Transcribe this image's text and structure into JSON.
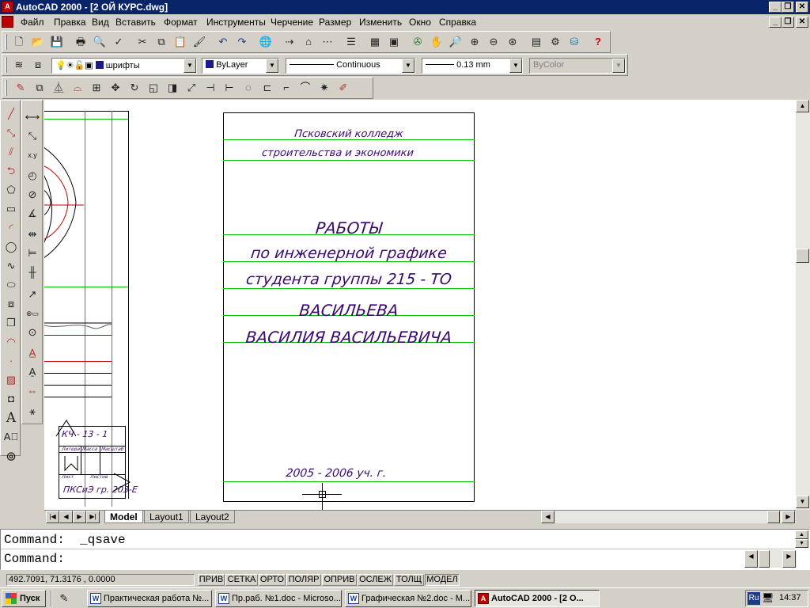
{
  "titlebar": {
    "title": "AutoCAD 2000 - [2 ОЙ КУРС.dwg]",
    "app_icon_glyph": "A"
  },
  "menu": [
    "Файл",
    "Правка",
    "Вид",
    "Вставить",
    "Формат",
    "Инструменты",
    "Черчение",
    "Размер",
    "Изменить",
    "Окно",
    "Справка"
  ],
  "standard_toolbar": {
    "help_glyph": "?"
  },
  "properties_toolbar": {
    "layer": "шрифты",
    "color": "ByLayer",
    "linetype": "Continuous",
    "lineweight": "0.13 mm",
    "plotstyle": "ByColor"
  },
  "icons": {
    "standard": [
      "new-icon",
      "open-icon",
      "save-icon",
      "print-icon",
      "preview-icon",
      "spell-icon",
      "cut-icon",
      "copy-icon",
      "paste-icon",
      "match-prop-icon",
      "undo-icon",
      "redo-icon",
      "hyperlink-icon",
      "snap-from-icon",
      "object-snap-icon",
      "tracking-icon",
      "properties-icon",
      "design-center-icon",
      "today-icon",
      "redraw-icon",
      "pan-icon",
      "zoom-realtime-icon",
      "zoom-window-icon",
      "zoom-prev-icon",
      "aerial-icon",
      "dbconnect-icon",
      "tool-palette-icon",
      "help-icon"
    ],
    "modify": [
      "erase-icon",
      "copy-object-icon",
      "mirror-icon",
      "offset-icon",
      "array-icon",
      "move-icon",
      "rotate-icon",
      "scale-icon",
      "stretch-icon",
      "lengthen-icon",
      "trim-icon",
      "extend-icon",
      "break-icon",
      "chamfer-icon",
      "fillet-icon",
      "explode-icon"
    ],
    "draw": [
      "line-icon",
      "construction-line-icon",
      "polyline-icon",
      "polygon-icon",
      "rectangle-icon",
      "arc-icon",
      "circle-icon",
      "spline-icon",
      "ellipse-icon",
      "insert-block-icon",
      "make-block-icon",
      "point-icon",
      "hatch-icon",
      "region-icon",
      "multiline-text-icon",
      "single-text-icon",
      "donut-icon"
    ],
    "dimension": [
      "linear-dim-icon",
      "aligned-dim-icon",
      "ordinate-dim-icon",
      "radius-dim-icon",
      "diameter-dim-icon",
      "angular-dim-icon",
      "quick-dim-icon",
      "baseline-dim-icon",
      "continue-dim-icon",
      "leader-icon",
      "tolerance-icon",
      "center-mark-icon",
      "dim-edit-icon",
      "dim-text-edit-icon",
      "dim-update-icon",
      "dim-style-icon"
    ]
  },
  "drawing": {
    "title_block": {
      "college_line1": "Псковский колледж",
      "college_line2": "строительства и экономики",
      "work_title": "РАБОТЫ",
      "subject": "по инженерной графике",
      "student_group": "студента группы 215 - ТО",
      "surname": "ВАСИЛЬЕВА",
      "name": "ВАСИЛИЯ ВАСИЛЬЕВИЧА",
      "year": "2005 - 2006 уч. г."
    },
    "left_sheet": {
      "stamp_code": "КЧ - 13 - 1",
      "stamp_cols": [
        "Литера",
        "Масса",
        "Масштаб"
      ],
      "stamp_sheet": [
        "Лист",
        "Листов"
      ],
      "stamp_org": "ПКСиЭ гр. 203-Е"
    }
  },
  "tabs": {
    "items": [
      "Model",
      "Layout1",
      "Layout2"
    ],
    "active": "Model"
  },
  "command": {
    "history": "Command:  _qsave",
    "prompt": "Command:"
  },
  "status": {
    "coords": "492.7091, 71.3176 , 0.0000",
    "toggles": [
      "ПРИВ",
      "СЕТКА",
      "ОРТО",
      "ПОЛЯР",
      "ОПРИВ",
      "ОСЛЕЖ",
      "ТОЛЩ",
      "МОДЕЛ"
    ]
  },
  "taskbar": {
    "start": "Пуск",
    "tasks": [
      {
        "label": "Практическая работа №...",
        "icon": "W"
      },
      {
        "label": "Пр.раб. №1.doc - Microso...",
        "icon": "W"
      },
      {
        "label": "Графическая №2.doc - M...",
        "icon": "W"
      },
      {
        "label": "AutoCAD 2000 - [2 О...",
        "icon": "A"
      }
    ],
    "tray_lang": "Ru",
    "clock": "14:37"
  },
  "colors": {
    "titlebar": "#0a246a",
    "grid_lines": "#00c000",
    "text_ink": "#3a0a6e",
    "red_lines": "#d00000"
  }
}
